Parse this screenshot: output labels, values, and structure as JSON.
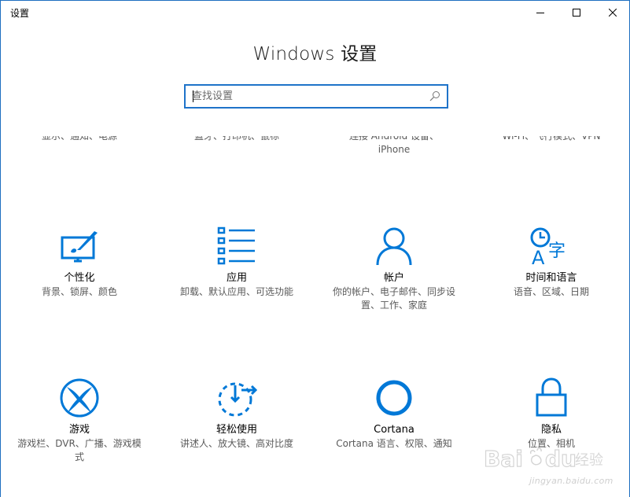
{
  "window": {
    "title": "设置",
    "controls": {
      "minimize": "minimize",
      "maximize": "maximize",
      "close": "close"
    }
  },
  "heading": "Windows 设置",
  "search": {
    "placeholder": "查找设置",
    "value": ""
  },
  "partial_row": [
    {
      "desc_line1": "显示、通知、电源",
      "desc_line2": ""
    },
    {
      "desc_line1": "蓝牙、打印机、鼠标",
      "desc_line2": ""
    },
    {
      "desc_line1": "连接 Android 设备、",
      "desc_line2": "iPhone"
    },
    {
      "desc_line1": "Wi-Fi、飞行模式、VPN",
      "desc_line2": ""
    }
  ],
  "tiles": [
    {
      "name": "个性化",
      "desc": "背景、锁屏、颜色",
      "icon": "personalization-icon"
    },
    {
      "name": "应用",
      "desc": "卸载、默认应用、可选功能",
      "icon": "apps-icon"
    },
    {
      "name": "帐户",
      "desc": "你的帐户、电子邮件、同步设置、工作、家庭",
      "icon": "accounts-icon"
    },
    {
      "name": "时间和语言",
      "desc": "语音、区域、日期",
      "icon": "time-language-icon"
    },
    {
      "name": "游戏",
      "desc": "游戏栏、DVR、广播、游戏模式",
      "icon": "gaming-icon"
    },
    {
      "name": "轻松使用",
      "desc": "讲述人、放大镜、高对比度",
      "icon": "ease-of-access-icon"
    },
    {
      "name": "Cortana",
      "desc": "Cortana 语言、权限、通知",
      "icon": "cortana-icon"
    },
    {
      "name": "隐私",
      "desc": "位置、相机",
      "icon": "privacy-icon"
    }
  ],
  "watermark": {
    "text": "jingyan.baidu.com",
    "brand": "Baidu 经验"
  },
  "colors": {
    "accent": "#0078d7",
    "border": "#1e73c9",
    "desc_text": "#5a5a5a"
  }
}
